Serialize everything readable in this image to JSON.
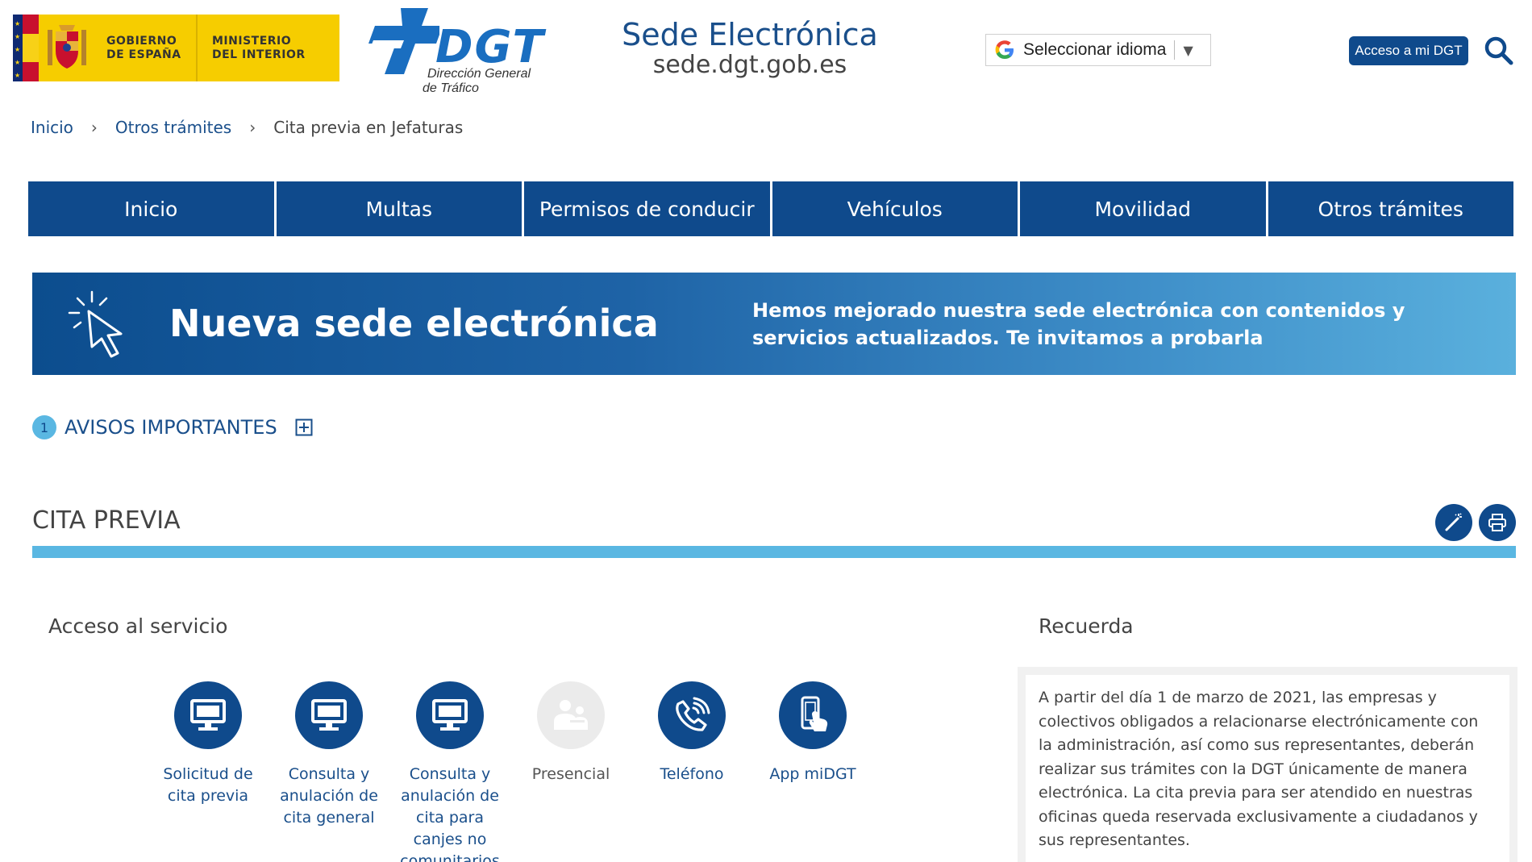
{
  "header": {
    "gov_line1": "Gobierno",
    "gov_line2": "de España",
    "ministry_line1": "Ministerio",
    "ministry_line2": "del Interior",
    "dgt_name": "DGT",
    "dgt_sub_line1": "Dirección General",
    "dgt_sub_line2": "de Tráfico",
    "sede_title": "Sede Electrónica",
    "sede_url": "sede.dgt.gob.es",
    "language_select_label": "Seleccionar idioma",
    "language_arrow": "▼",
    "access_button": "Acceso a mi DGT"
  },
  "breadcrumb": {
    "items": [
      "Inicio",
      "Otros trámites",
      "Cita previa en Jefaturas"
    ],
    "separator": "›"
  },
  "nav": {
    "items": [
      "Inicio",
      "Multas",
      "Permisos de conducir",
      "Vehículos",
      "Movilidad",
      "Otros trámites"
    ]
  },
  "banner": {
    "title": "Nueva sede electrónica",
    "text": "Hemos mejorado nuestra sede electrónica con contenidos y servicios actualizados. Te invitamos a probarla"
  },
  "avisos": {
    "count": "1",
    "label": "AVISOS IMPORTANTES"
  },
  "cita": {
    "title": "CITA PREVIA"
  },
  "acceso": {
    "title": "Acceso al servicio",
    "services": [
      {
        "label": "Solicitud de cita previa",
        "icon": "monitor-icon",
        "enabled": true
      },
      {
        "label": "Consulta y anulación de cita general",
        "icon": "monitor-icon",
        "enabled": true
      },
      {
        "label": "Consulta y anulación de cita para canjes no comunitarios",
        "icon": "monitor-icon",
        "enabled": true
      },
      {
        "label": "Presencial",
        "icon": "people-icon",
        "enabled": false
      },
      {
        "label": "Teléfono",
        "icon": "phone-icon",
        "enabled": true
      },
      {
        "label": "App miDGT",
        "icon": "mobile-app-icon",
        "enabled": true
      }
    ]
  },
  "recuerda": {
    "title": "Recuerda",
    "text": "A partir del día 1 de marzo de 2021, las empresas y colectivos obligados a relacionarse electrónicamente con la administración, así como sus representantes, deberán realizar sus trámites con la DGT únicamente de manera electrónica. La cita previa para ser atendido en nuestras oficinas queda reservada exclusivamente a ciudadanos y sus representantes."
  },
  "colors": {
    "primary": "#0f4a8c",
    "accent": "#5ab7e2",
    "gov_yellow": "#f6cd00"
  }
}
